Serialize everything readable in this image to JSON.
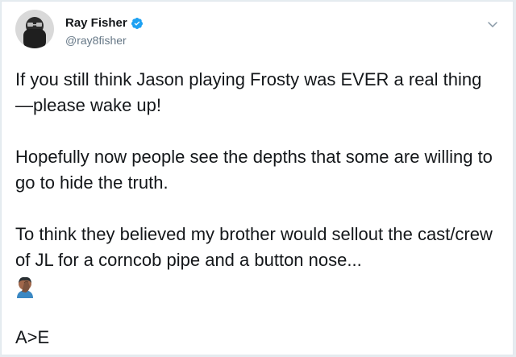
{
  "user": {
    "name": "Ray Fisher",
    "handle": "@ray8fisher"
  },
  "icons": {
    "avatar": "profile-photo",
    "verified": "verified-badge-icon",
    "more": "chevron-down-icon",
    "emoji": "person-facepalming-emoji"
  },
  "colors": {
    "verified_blue": "#1da1f2",
    "text": "#14171a",
    "secondary": "#657786"
  },
  "tweet": {
    "p1": "If you still think Jason playing Frosty was EVER a real thing—please wake up!",
    "p2": "Hopefully now people see the depths that some are willing to go to hide the truth.",
    "p3": "To think they believed my brother would sellout the cast/crew of JL for a corncob pipe and a button nose...",
    "p4": "A>E"
  }
}
